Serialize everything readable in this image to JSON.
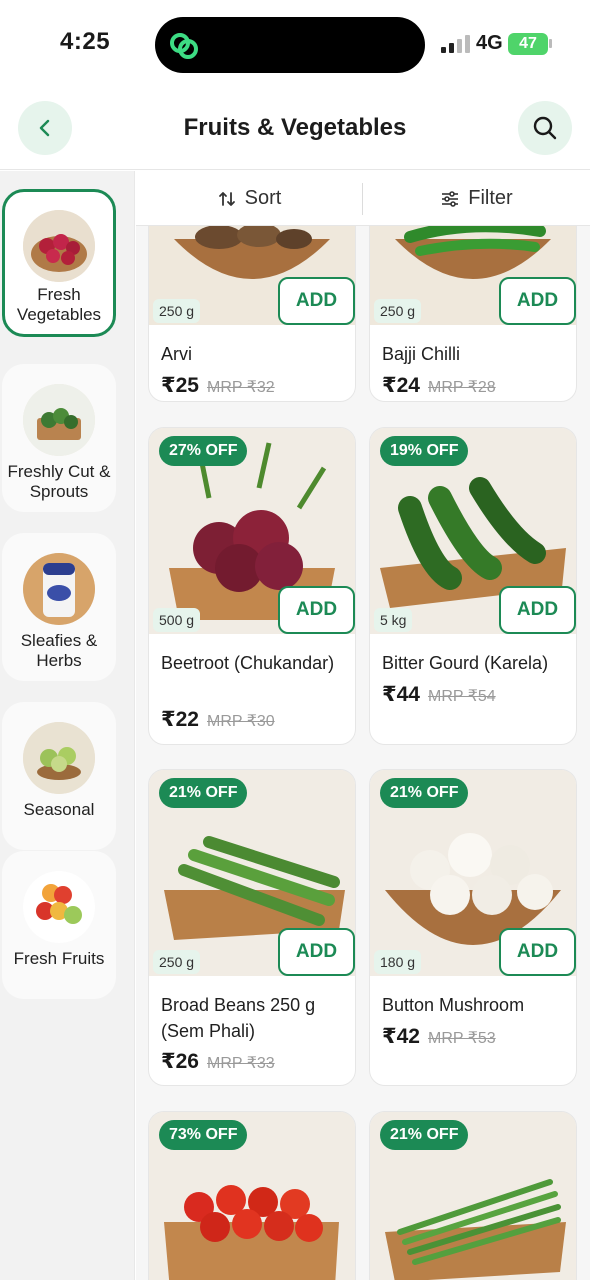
{
  "status_bar": {
    "time": "4:25",
    "network": "4G",
    "battery": "47"
  },
  "header": {
    "title": "Fruits & Vegetables",
    "back_icon": "chevron-left-icon",
    "search_icon": "search-icon"
  },
  "sidebar": {
    "items": [
      {
        "label": "Fresh Vegetables",
        "active": true
      },
      {
        "label": "Freshly Cut & Sprouts",
        "active": false
      },
      {
        "label": "Sleafies & Herbs",
        "active": false
      },
      {
        "label": "Seasonal",
        "active": false
      },
      {
        "label": "Fresh Fruits",
        "active": false
      }
    ]
  },
  "toolbar": {
    "sort_label": "Sort",
    "filter_label": "Filter"
  },
  "products": [
    {
      "name": "Arvi",
      "weight": "250 g",
      "price": "₹25",
      "mrp": "MRP ₹32",
      "discount": "",
      "add_label": "ADD"
    },
    {
      "name": "Bajji Chilli",
      "weight": "250 g",
      "price": "₹24",
      "mrp": "MRP ₹28",
      "discount": "",
      "add_label": "ADD"
    },
    {
      "name": "Beetroot (Chukandar)",
      "weight": "500 g",
      "price": "₹22",
      "mrp": "MRP ₹30",
      "discount": "27% OFF",
      "add_label": "ADD"
    },
    {
      "name": "Bitter Gourd (Karela)",
      "weight": "5 kg",
      "price": "₹44",
      "mrp": "MRP ₹54",
      "discount": "19% OFF",
      "add_label": "ADD"
    },
    {
      "name": "Broad Beans 250 g (Sem Phali)",
      "weight": "250 g",
      "price": "₹26",
      "mrp": "MRP ₹33",
      "discount": "21% OFF",
      "add_label": "ADD"
    },
    {
      "name": "Button Mushroom",
      "weight": "180 g",
      "price": "₹42",
      "mrp": "MRP ₹53",
      "discount": "21% OFF",
      "add_label": "ADD"
    },
    {
      "name": "",
      "weight": "",
      "price": "",
      "mrp": "",
      "discount": "73% OFF",
      "add_label": ""
    },
    {
      "name": "",
      "weight": "",
      "price": "",
      "mrp": "",
      "discount": "21% OFF",
      "add_label": ""
    }
  ],
  "colors": {
    "accent": "#1c8a55",
    "accent_light": "#e6f4ec",
    "badge_text": "#ffffff"
  }
}
